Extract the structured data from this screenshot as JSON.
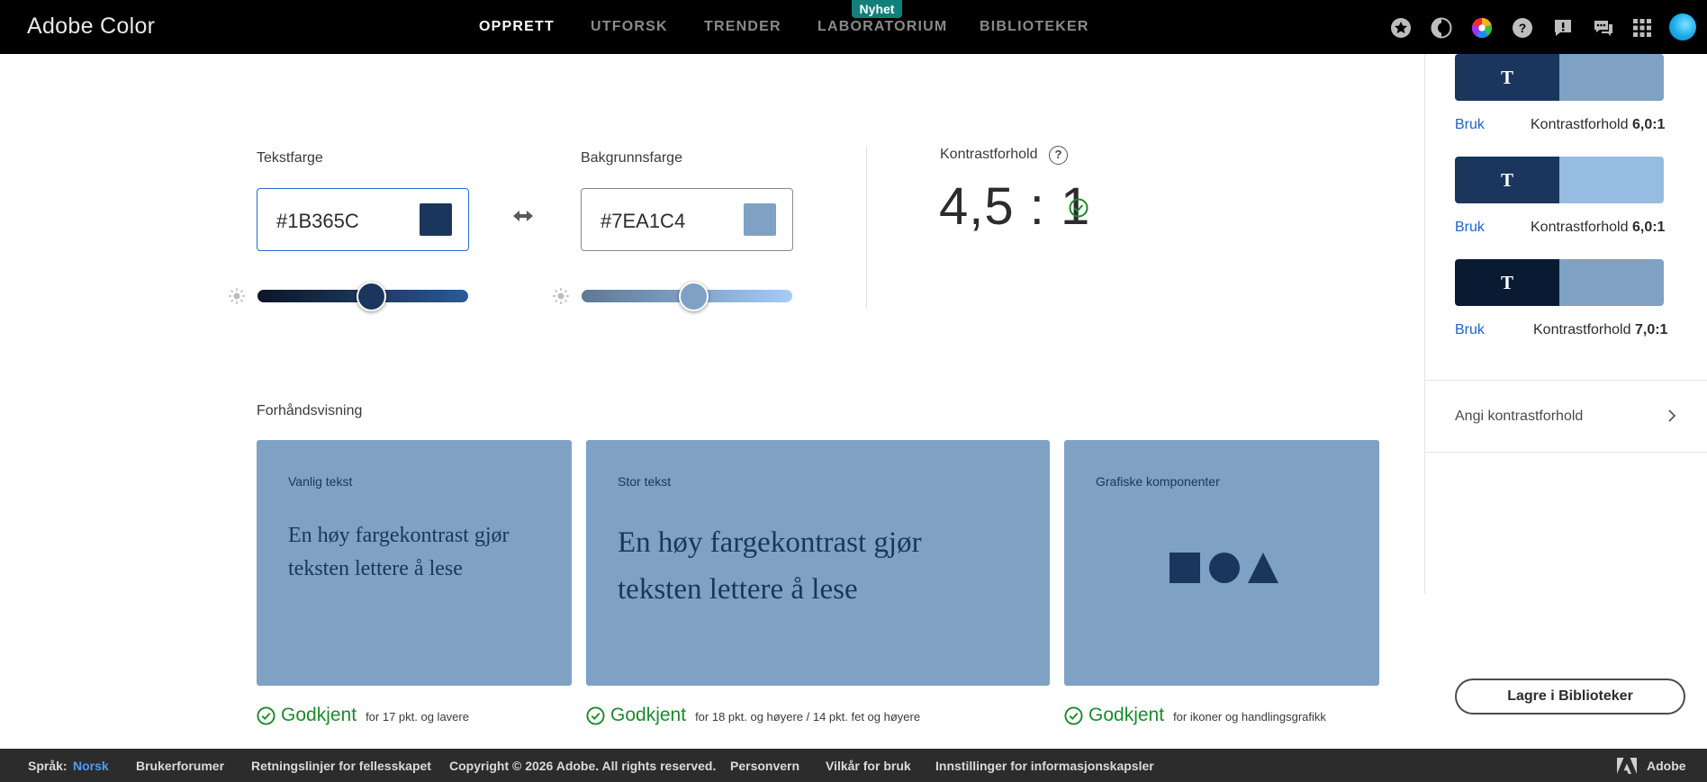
{
  "header": {
    "brand": "Adobe Color",
    "nav": [
      "OPPRETT",
      "UTFORSK",
      "TRENDER",
      "LABORATORIUM",
      "BIBLIOTEKER"
    ],
    "active_nav": "OPPRETT",
    "badge": "Nyhet",
    "icons": [
      "star-icon",
      "contrast-icon",
      "color-wheel-icon",
      "help-icon",
      "feedback-icon",
      "chat-icon",
      "apps-grid-icon",
      "avatar"
    ]
  },
  "text_color": {
    "label": "Tekstfarge",
    "hex": "#1B365C",
    "brightness_percent": 54
  },
  "bg_color": {
    "label": "Bakgrunnsfarge",
    "hex": "#7EA1C4",
    "brightness_percent": 53
  },
  "contrast": {
    "label": "Kontrastforhold",
    "value": "4,5 : 1",
    "status": "pass"
  },
  "preview": {
    "title": "Forhåndsvisning",
    "cards": [
      {
        "title": "Vanlig tekst",
        "sample": "En høy fargekontrast gjør teksten lettere å lese",
        "status": "Godkjent",
        "desc": "for 17 pkt. og lavere"
      },
      {
        "title": "Stor tekst",
        "sample": "En høy fargekontrast gjør teksten lettere å lese",
        "status": "Godkjent",
        "desc": "for 18 pkt. og høyere / 14 pkt. fet og høyere"
      },
      {
        "title": "Grafiske komponenter",
        "status": "Godkjent",
        "desc": "for ikoner og handlingsgrafikk"
      }
    ]
  },
  "sidebar": {
    "sample_glyph": "T",
    "suggestions": [
      {
        "text_color": "#1b365c",
        "bg_color": "#7ea1c4",
        "use": "Bruk",
        "ratio_label": "Kontrastforhold",
        "ratio": "6,0:1"
      },
      {
        "text_color": "#1b365c",
        "bg_color": "#97bce2",
        "use": "Bruk",
        "ratio_label": "Kontrastforhold",
        "ratio": "6,0:1"
      },
      {
        "text_color": "#0b1a33",
        "bg_color": "#7ea1c4",
        "use": "Bruk",
        "ratio_label": "Kontrastforhold",
        "ratio": "7,0:1"
      }
    ],
    "set_ratio": "Angi kontrastforhold",
    "save_button": "Lagre i Biblioteker"
  },
  "footer": {
    "language_label": "Språk:",
    "language": "Norsk",
    "links": [
      "Brukerforumer",
      "Retningslinjer for fellesskapet",
      "Copyright © 2026 Adobe. All rights reserved.",
      "Personvern",
      "Vilkår for bruk",
      "Innstillinger for informasjonskapsler"
    ],
    "adobe": "Adobe"
  }
}
